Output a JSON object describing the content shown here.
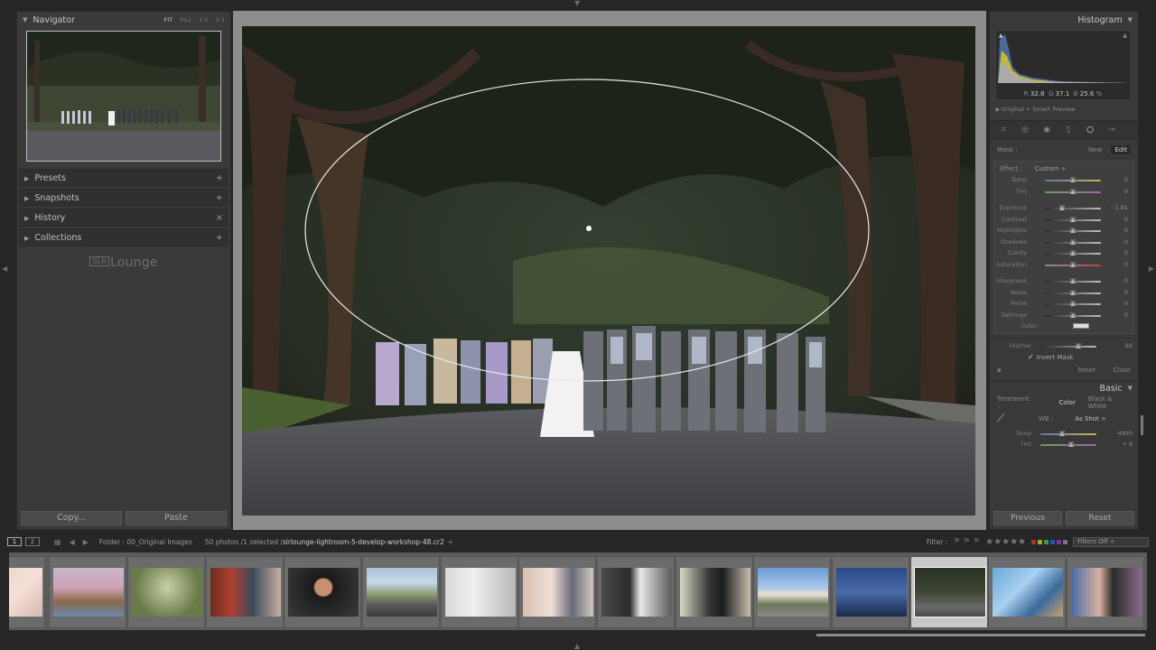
{
  "navigator": {
    "title": "Navigator",
    "zoom_options": [
      "FIT",
      "FILL",
      "1:1",
      "3:1"
    ]
  },
  "left_panels": [
    {
      "label": "Presets",
      "action": "+"
    },
    {
      "label": "Snapshots",
      "action": "+"
    },
    {
      "label": "History",
      "action": "×"
    },
    {
      "label": "Collections",
      "action": "+"
    }
  ],
  "logo": {
    "box": "SLR",
    "text": "Lounge"
  },
  "left_buttons": {
    "copy": "Copy...",
    "paste": "Paste"
  },
  "histogram": {
    "title": "Histogram",
    "r_label": "R",
    "r_value": "32.8",
    "g_label": "G",
    "g_value": "37.1",
    "b_label": "B",
    "b_value": "25.6",
    "unit": "%",
    "smart_preview": "Original + Smart Preview"
  },
  "mask": {
    "label": "Mask :",
    "new": "New",
    "edit": "Edit"
  },
  "effect": {
    "label": "Effect :",
    "value": "Custom ÷"
  },
  "sliders": [
    {
      "label": "Temp",
      "value": "0",
      "pos": 0.5,
      "track": "linear-gradient(to right,#5a7aa8,#c8b060)"
    },
    {
      "label": "Tint",
      "value": "0",
      "pos": 0.5,
      "track": "linear-gradient(to right,#6aa060,#a860a8)"
    },
    {
      "gap": true
    },
    {
      "label": "Exposure",
      "value": "– 1.81",
      "pos": 0.3,
      "track": "linear-gradient(to right,#2a2a2a,#bdbdbd)"
    },
    {
      "label": "Contrast",
      "value": "0",
      "pos": 0.5,
      "track": "linear-gradient(to right,#2a2a2a,#bdbdbd)"
    },
    {
      "label": "Highlights",
      "value": "0",
      "pos": 0.5,
      "track": "linear-gradient(to right,#2a2a2a,#bdbdbd)"
    },
    {
      "label": "Shadows",
      "value": "0",
      "pos": 0.5,
      "track": "linear-gradient(to right,#2a2a2a,#bdbdbd)"
    },
    {
      "label": "Clarity",
      "value": "0",
      "pos": 0.5,
      "track": "linear-gradient(to right,#2a2a2a,#bdbdbd)"
    },
    {
      "label": "Saturation",
      "value": "0",
      "pos": 0.5,
      "track": "linear-gradient(to right,#8a8a8a,#c04040)"
    },
    {
      "gap": true
    },
    {
      "label": "Sharpness",
      "value": "0",
      "pos": 0.5,
      "track": "linear-gradient(to right,#2a2a2a,#bdbdbd)"
    },
    {
      "label": "Noise",
      "value": "0",
      "pos": 0.5,
      "track": "linear-gradient(to right,#2a2a2a,#bdbdbd)"
    },
    {
      "label": "Moiré",
      "value": "0",
      "pos": 0.5,
      "track": "linear-gradient(to right,#2a2a2a,#bdbdbd)"
    },
    {
      "label": "Defringe",
      "value": "0",
      "pos": 0.5,
      "track": "linear-gradient(to right,#2a2a2a,#bdbdbd)"
    }
  ],
  "color_label": "Color",
  "feather": {
    "label": "Feather",
    "value": "69",
    "pos": 0.68
  },
  "invert_mask": "Invert Mask",
  "reset": "Reset",
  "close": "Close",
  "basic": {
    "title": "Basic",
    "treatment_label": "Treatment :",
    "color": "Color",
    "bw": "Black & White",
    "wb_label": "WB :",
    "wb_value": "As Shot ÷",
    "temp": {
      "label": "Temp",
      "value": "4950",
      "pos": 0.38
    },
    "tint": {
      "label": "Tint",
      "value": "+ 9",
      "pos": 0.55
    }
  },
  "right_buttons": {
    "previous": "Previous",
    "reset": "Reset"
  },
  "film_bar": {
    "page1": "1",
    "page2": "2",
    "folder": "Folder : 00_Original Images",
    "count": "50 photos /1 selected /",
    "file": "slrlounge-lightroom-5-develop-workshop-48.cr2",
    "file_arrow": "÷",
    "filter_label": "Filter :",
    "filters_off": "Filters Off ÷"
  },
  "icons": [
    "grid-icon",
    "prev-arrow-icon",
    "next-arrow-icon",
    "hand-icon",
    "eyedropper-icon"
  ]
}
